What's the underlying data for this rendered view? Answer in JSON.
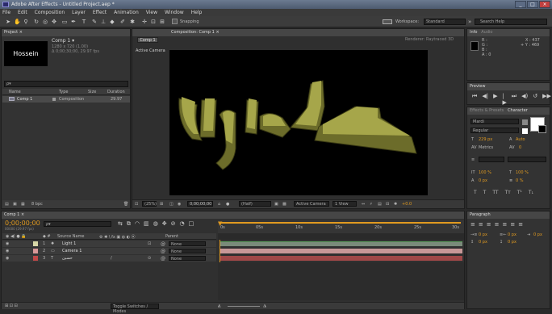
{
  "window": {
    "title": "Adobe After Effects - Untitled Project.aep *",
    "min": "_",
    "max": "□",
    "close": "×"
  },
  "menu": [
    "File",
    "Edit",
    "Composition",
    "Layer",
    "Effect",
    "Animation",
    "View",
    "Window",
    "Help"
  ],
  "toolbar": {
    "snapping": "Snapping",
    "workspace_label": "Workspace:",
    "workspace_value": "Standard",
    "search": "Search Help"
  },
  "project": {
    "tab": "Project",
    "thumb_text": "Hossein",
    "comp_name": "Comp 1 ▾",
    "comp_info1": "1280 x 720 (1.00)",
    "comp_info2": "Δ 0;00;30;00, 29.97 fps",
    "search_placeholder": "ρ▾",
    "col_name": "Name",
    "col_type": "Type",
    "col_size": "Size",
    "col_dur": "Duration",
    "items": [
      {
        "name": "Comp 1",
        "type": "Composition",
        "duration": "29.97"
      }
    ],
    "bpc": "8 bpc"
  },
  "composition": {
    "tab": "Composition: Comp 1",
    "sub_tab": "Comp 1",
    "renderer": "Renderer:  Raytraced 3D",
    "camera_label": "Active Camera",
    "zoom": "(25%)",
    "timecode": "0;00;00;00",
    "resolution": "(Half)",
    "view": "Active Camera",
    "views": "1 View",
    "exposure": "+0.0"
  },
  "info": {
    "tab_info": "Info",
    "tab_audio": "Audio",
    "r": "R :",
    "g": "G :",
    "b": "B :",
    "a": "A : 0",
    "x": "X : 437",
    "y": "+ Y : 469"
  },
  "preview": {
    "tab": "Preview"
  },
  "effects": {
    "tab_fx": "Effects & Presets",
    "tab_char": "Character",
    "font": "Mardi",
    "style": "Regular",
    "size": "229 px",
    "leading": "Auto",
    "kerning": "Metrics",
    "tracking": "0",
    "stroke": "",
    "scale_v": "100 %",
    "scale_h": "100 %",
    "baseline": "0 px",
    "tsume": "0 %"
  },
  "paragraph": {
    "tab": "Paragraph",
    "indent1": "0 px",
    "indent2": "0 px",
    "indent3": "0 px",
    "space1": "0 px",
    "space2": "0 px"
  },
  "timeline": {
    "tab": "Comp 1",
    "timecode": "0;00;00;00",
    "fps": "00000 (29.97 fps)",
    "search_placeholder": "ρ▾",
    "col_source": "Source Name",
    "col_parent": "Parent",
    "layers": [
      {
        "num": "1",
        "name": "Light 1",
        "color": "#d8d8a8",
        "parent": "None",
        "bar": "#7a8a7a"
      },
      {
        "num": "2",
        "name": "Camera 1",
        "color": "#d89898",
        "parent": "None",
        "bar": "#c89898"
      },
      {
        "num": "3",
        "name": "حسين",
        "color": "#c04848",
        "parent": "None",
        "bar": "#a04848"
      }
    ],
    "ruler": [
      "0s",
      "05s",
      "10s",
      "15s",
      "20s",
      "25s",
      "30s"
    ],
    "toggle": "Toggle Switches / Modes"
  },
  "colors": {
    "accent_orange": "#e09a20",
    "text_3d": "#8e8e3a",
    "bg_comp": "#000000"
  }
}
